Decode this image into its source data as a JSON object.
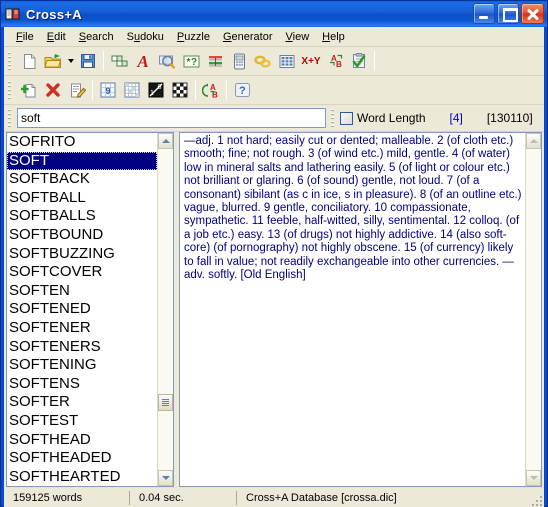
{
  "window": {
    "title": "Cross+A",
    "icon": "book-icon",
    "buttons": {
      "minimize": "Minimize",
      "maximize": "Maximize",
      "close": "Close"
    }
  },
  "menubar": {
    "items": [
      {
        "label": "File",
        "accel": "F"
      },
      {
        "label": "Edit",
        "accel": "E"
      },
      {
        "label": "Search",
        "accel": "S"
      },
      {
        "label": "Sudoku",
        "accel": "u"
      },
      {
        "label": "Puzzle",
        "accel": "P"
      },
      {
        "label": "Generator",
        "accel": "G"
      },
      {
        "label": "View",
        "accel": "V"
      },
      {
        "label": "Help",
        "accel": "H"
      }
    ]
  },
  "toolbar_top": {
    "buttons": [
      {
        "name": "new-document-icon",
        "title": "New"
      },
      {
        "name": "open-folder-icon",
        "title": "Open"
      },
      {
        "name": "open-dropdown-arrow-icon",
        "title": "Recent files"
      },
      {
        "name": "save-floppy-icon",
        "title": "Save"
      },
      {
        "name": "crossword-grid-icon",
        "title": "Crossword"
      },
      {
        "name": "anagram-letter-a-icon",
        "title": "Anagram"
      },
      {
        "name": "dictionary-search-icon",
        "title": "Dictionary search"
      },
      {
        "name": "wildcard-search-icon",
        "title": "Pattern search"
      },
      {
        "name": "word-ladder-icon",
        "title": "Word ladder"
      },
      {
        "name": "cryptogram-icon",
        "title": "Cryptogram"
      },
      {
        "name": "chain-links-icon",
        "title": "Chain words"
      },
      {
        "name": "number-grid-icon",
        "title": "Number grid"
      },
      {
        "name": "math-xy-icon",
        "title": "X+Y",
        "label": "X+Y"
      },
      {
        "name": "letter-substitution-icon",
        "title": "Letter substitution"
      },
      {
        "name": "checklist-icon",
        "title": "Check"
      }
    ]
  },
  "toolbar_bottom": {
    "buttons": [
      {
        "name": "add-word-icon",
        "title": "Add word"
      },
      {
        "name": "delete-word-icon",
        "title": "Delete word"
      },
      {
        "name": "edit-word-icon",
        "title": "Edit word"
      },
      {
        "name": "sudoku-icon",
        "title": "Sudoku"
      },
      {
        "name": "kakuro-icon",
        "title": "Kakuro"
      },
      {
        "name": "kakurasu-icon",
        "title": "Kakurasu"
      },
      {
        "name": "nonogram-icon",
        "title": "Nonogram"
      },
      {
        "name": "a-to-b-icon",
        "title": "A to B"
      },
      {
        "name": "help-question-icon",
        "title": "Help"
      }
    ]
  },
  "search": {
    "value": "soft",
    "placeholder": "",
    "word_length_label": "Word Length",
    "word_length_checked": false,
    "matched_count": "[4]",
    "total_count": "[130110]"
  },
  "word_list": {
    "selected": "SOFT",
    "items": [
      "SOFRITO",
      "SOFT",
      "SOFTBACK",
      "SOFTBALL",
      "SOFTBALLS",
      "SOFTBOUND",
      "SOFTBUZZING",
      "SOFTCOVER",
      "SOFTEN",
      "SOFTENED",
      "SOFTENER",
      "SOFTENERS",
      "SOFTENING",
      "SOFTENS",
      "SOFTER",
      "SOFTEST",
      "SOFTHEAD",
      "SOFTHEADED",
      "SOFTHEARTED"
    ]
  },
  "definition": {
    "text": "—adj. 1 not hard; easily cut or dented; malleable. 2 (of cloth etc.) smooth; fine; not rough. 3 (of wind etc.) mild, gentle. 4 (of water) low in mineral salts and lathering easily. 5 (of light or colour etc.) not brilliant or glaring. 6 (of sound) gentle, not loud. 7 (of a consonant) sibilant (as c in ice, s in pleasure). 8 (of an outline etc.) vague, blurred. 9 gentle, conciliatory. 10 compassionate, sympathetic. 11 feeble, half-witted, silly, sentimental. 12 colloq. (of a job etc.) easy. 13 (of drugs) not highly addictive. 14 (also soft-core) (of pornography) not highly obscene. 15 (of currency) likely to fall in value; not readily exchangeable into other currencies. —adv. softly. [Old English]"
  },
  "statusbar": {
    "words": "159125 words",
    "time": "0.04 sec.",
    "database": "Cross+A Database [crossa.dic]"
  },
  "colors": {
    "title_blue": "#0a49c8",
    "selection": "#000080",
    "definition_text": "#000080",
    "accent_count": "#0000c0",
    "face": "#ece9d8"
  }
}
